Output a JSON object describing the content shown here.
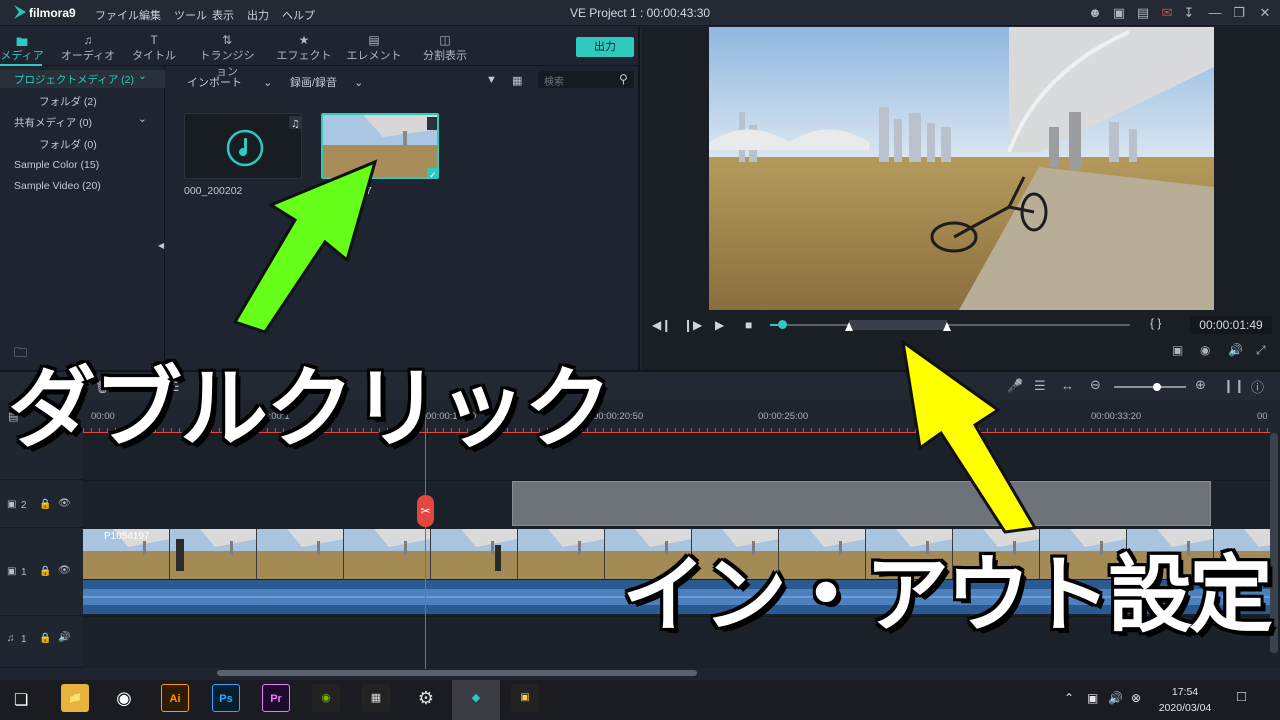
{
  "app": {
    "name": "filmora9",
    "project_title": "VE Project 1 : 00:00:43:30"
  },
  "menu": [
    "ファイル",
    "編集",
    "ツール",
    "表示",
    "出力",
    "ヘルプ"
  ],
  "media_tabs": [
    {
      "label": "メディア",
      "icon": "folder-icon"
    },
    {
      "label": "オーディオ",
      "icon": "music-note-icon"
    },
    {
      "label": "タイトル",
      "icon": "text-icon"
    },
    {
      "label": "トランジション",
      "icon": "transition-icon"
    },
    {
      "label": "エフェクト",
      "icon": "effects-icon"
    },
    {
      "label": "エレメント",
      "icon": "image-icon"
    },
    {
      "label": "分割表示",
      "icon": "split-screen-icon"
    }
  ],
  "export_label": "出力",
  "tree": {
    "project_media": "プロジェクトメディア (2)",
    "folder1": "フォルダ (2)",
    "shared_media": "共有メディア (0)",
    "folder2": "フォルダ (0)",
    "sample_color": "Sample Color (15)",
    "sample_video": "Sample Video (20)"
  },
  "lib_toolbar": {
    "import": "インポート",
    "record": "録画/録音",
    "search_placeholder": "検索"
  },
  "clips": {
    "audio_name": "000_200202",
    "video_name_partial": "7"
  },
  "preview": {
    "timecode": "00:00:01:49",
    "brackets": "{ }"
  },
  "ruler_labels": [
    "00:00",
    "00:00:1",
    "00:00:16:40",
    "00:00:20:50",
    "00:00:25:00",
    "00:00:33:20",
    "00"
  ],
  "tracks": [
    {
      "id": "video2",
      "label": "2"
    },
    {
      "id": "video1",
      "label": "1",
      "clip_name": "P1054197"
    },
    {
      "id": "audio1",
      "label": "1"
    }
  ],
  "overlay": {
    "double_click": "ダブルクリック",
    "in_out": "イン・アウト設定"
  },
  "taskbar": {
    "time": "17:54",
    "date": "2020/03/04",
    "apps": [
      "Ai",
      "Ps",
      "Pr"
    ]
  },
  "colors": {
    "accent": "#2fc9bf",
    "playhead": "#e2463f",
    "arrow_green": "#66ff1a",
    "arrow_yellow": "#ffff00"
  }
}
